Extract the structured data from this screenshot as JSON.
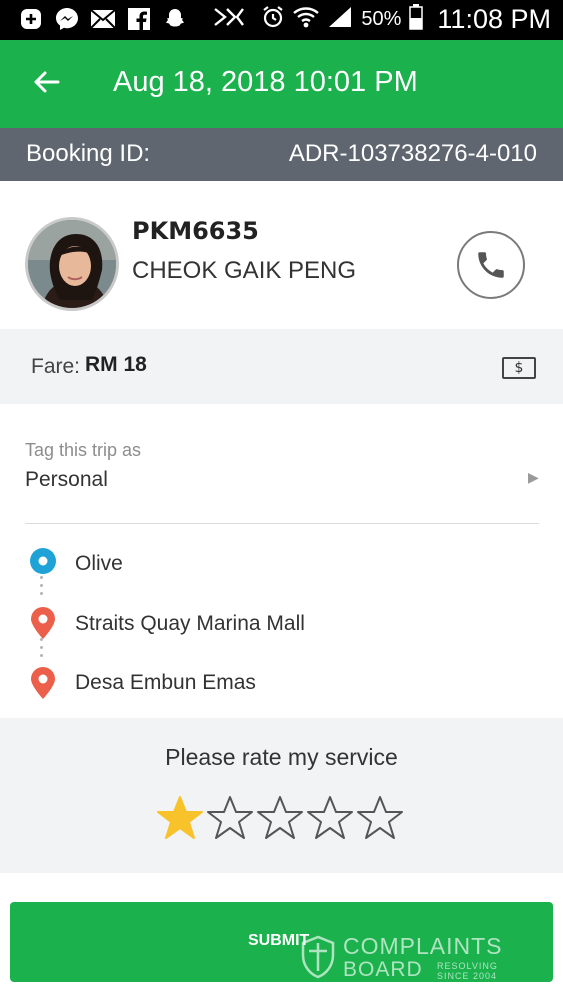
{
  "status_bar": {
    "battery": "50%",
    "time": "11:08 PM",
    "left_icons": [
      "add-icon",
      "messenger-icon",
      "mail-icon",
      "facebook-icon",
      "snapchat-icon"
    ],
    "right_icons": [
      "nfc-icon",
      "mute-icon",
      "alarm-icon",
      "wifi-icon",
      "signal-icon",
      "battery-icon"
    ]
  },
  "app_bar": {
    "title": "Aug 18, 2018 10:01 PM",
    "color": "#1bb14d"
  },
  "booking": {
    "label": "Booking ID:",
    "id": "ADR-103738276-4-010"
  },
  "driver": {
    "plate": "PKM6635",
    "name": "CHEOK GAIK PENG"
  },
  "fare": {
    "label": "Fare:",
    "value": "RM 18",
    "icon_text": "$"
  },
  "trip_tag": {
    "label": "Tag this trip as",
    "value": "Personal"
  },
  "route": {
    "stops": [
      {
        "name": "Olive",
        "type": "pickup",
        "color": "#1fa3d6"
      },
      {
        "name": "Straits Quay Marina Mall",
        "type": "waypoint",
        "color": "#ec5f4a"
      },
      {
        "name": "Desa Embun Emas",
        "type": "dropoff",
        "color": "#ec5f4a"
      }
    ]
  },
  "rating": {
    "prompt": "Please rate my service",
    "value": 1,
    "max": 5,
    "filled_color": "#f8c32a"
  },
  "submit": {
    "label": "SUBMIT"
  },
  "watermark": {
    "line1": "COMPLAINTS",
    "line2": "BOARD",
    "line3a": "RESOLVING",
    "line3b": "SINCE 2004"
  }
}
